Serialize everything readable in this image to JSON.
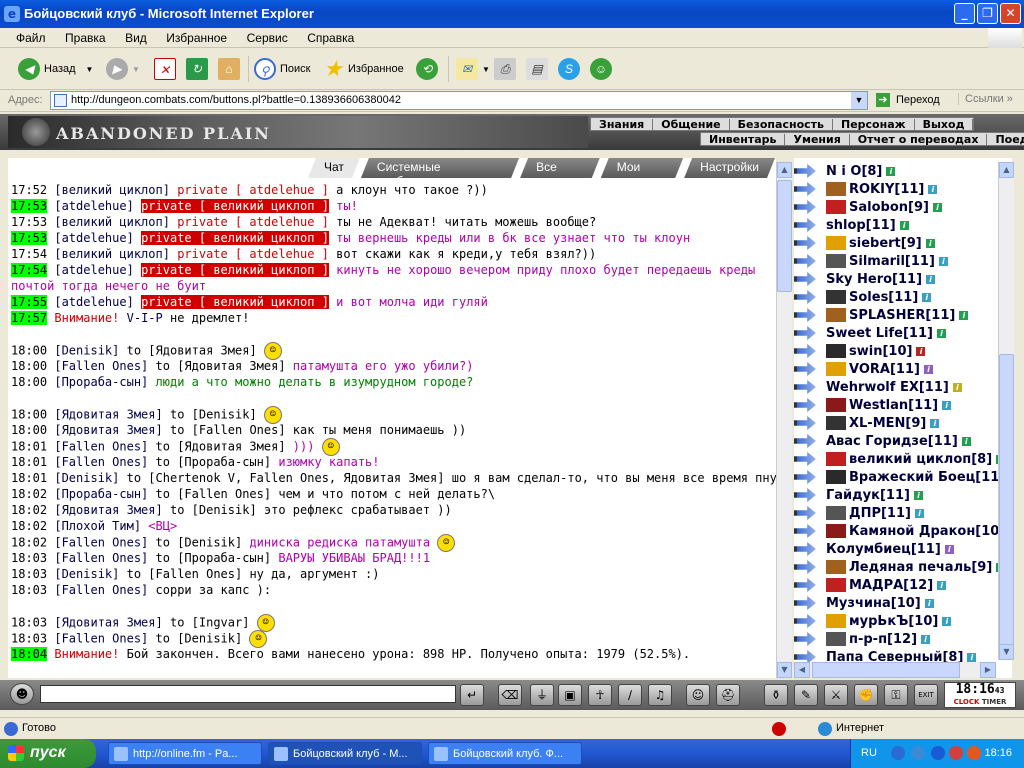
{
  "window": {
    "title": "Бойцовский клуб - Microsoft Internet Explorer",
    "icon": "ie-icon"
  },
  "menu": [
    "Файл",
    "Правка",
    "Вид",
    "Избранное",
    "Сервис",
    "Справка"
  ],
  "toolbar": {
    "back": "Назад",
    "search": "Поиск",
    "favorites": "Избранное"
  },
  "address": {
    "label": "Адрес:",
    "url": "http://dungeon.combats.com/buttons.pl?battle=0.138936606380042",
    "go": "Переход",
    "links": "Ссылки"
  },
  "game": {
    "location": "ABANDONED PLAIN",
    "nav_top": [
      "Знания",
      "Общение",
      "Безопасность",
      "Персонаж",
      "Выход"
    ],
    "nav_bottom": [
      "Инвентарь",
      "Умения",
      "Отчет о переводах",
      "Поединки",
      "А"
    ]
  },
  "tabs": [
    "Чат",
    "Системные сообщения",
    "Все логи",
    "Мои логи",
    "Настройки"
  ],
  "chat": [
    {
      "time": "17:52",
      "hl": false,
      "name": "[великий циклоп]",
      "private": "private [ atdelehue ]",
      "text": "а клоун что такое ?))"
    },
    {
      "time": "17:53",
      "hl": true,
      "name": "[atdelehue]",
      "private": "private [ великий циклоп ]",
      "text": "ты!"
    },
    {
      "time": "17:53",
      "hl": false,
      "name": "[великий циклоп]",
      "private": "private [ atdelehue ]",
      "text": "ты не Адекват! читать можешь вообще?"
    },
    {
      "time": "17:53",
      "hl": true,
      "name": "[atdelehue]",
      "private": "private [ великий циклоп ]",
      "text": "ты вернешь креды или в бк все узнает что ты клоун"
    },
    {
      "time": "17:54",
      "hl": false,
      "name": "[великий циклоп]",
      "private": "private [ atdelehue ]",
      "text": "вот скажи как я креди,у тебя взял?))"
    },
    {
      "time": "17:54",
      "hl": true,
      "name": "[atdelehue]",
      "private": "private [ великий циклоп ]",
      "text": "кинуть не хорошо вечером приду плохо будет передаешь креды почтой тогда нечего не буит"
    },
    {
      "time": "17:55",
      "hl": true,
      "name": "[atdelehue]",
      "private": "private [ великий циклоп ]",
      "text": "и вот молча иди гуляй"
    },
    {
      "time": "17:57",
      "hl": true,
      "warn": "Внимание!",
      "name": "V-I-P",
      "text": "не дремлет!"
    },
    {
      "time": "18:00",
      "name": "[Denisik]",
      "to": "to [Ядовитая Змея]",
      "text": "",
      "smiley": "smiley-icon"
    },
    {
      "time": "18:00",
      "name": "[Fallen Ones]",
      "to": "to [Ядовитая Змея]",
      "text": "патамушта его ужо убили?)"
    },
    {
      "time": "18:00",
      "name": "[Прораба-сын]",
      "to": "",
      "text": "люди а что можно делать в изумрудном городе?"
    },
    {
      "time": "18:00",
      "name": "[Ядовитая Змея]",
      "to": "to [Denisik]",
      "text": "",
      "smiley": "viking-smiley-icon"
    },
    {
      "time": "18:00",
      "name": "[Ядовитая Змея]",
      "to": "to [Fallen Ones]",
      "text": "как ты меня понимаешь ))"
    },
    {
      "time": "18:01",
      "name": "[Fallen Ones]",
      "to": "to [Ядовитая Змея]",
      "text": ")))",
      "smiley": "ninja-smiley-icon"
    },
    {
      "time": "18:01",
      "name": "[Fallen Ones]",
      "to": "to [Прораба-сын]",
      "text": "изюмку капать!"
    },
    {
      "time": "18:01",
      "name": "[Denisik]",
      "to": "to [Chertenok V, Fallen Ones, Ядовитая Змея]",
      "text": "шо я вам сделал-то, что вы меня все время пнуть хотите? :)"
    },
    {
      "time": "18:02",
      "name": "[Прораба-сын]",
      "to": "to [Fallen Ones]",
      "text": "чем и что потом с ней делать?\\"
    },
    {
      "time": "18:02",
      "name": "[Ядовитая Змея]",
      "to": "to [Denisik]",
      "text": "это рефлекс срабатывает ))"
    },
    {
      "time": "18:02",
      "name": "[Плохой Тим]",
      "to": "",
      "text": "<ВЦ>"
    },
    {
      "time": "18:02",
      "name": "[Fallen Ones]",
      "to": "to [Denisik]",
      "text": "диниска редиска патамушта",
      "smiley": "angry-smiley-icon"
    },
    {
      "time": "18:03",
      "name": "[Fallen Ones]",
      "to": "to [Прораба-сын]",
      "text": "ВАРУЫ УБИВАЫ БРАД!!!1"
    },
    {
      "time": "18:03",
      "name": "[Denisik]",
      "to": "to [Fallen Ones]",
      "text": "ну да, аргумент :)"
    },
    {
      "time": "18:03",
      "name": "[Fallen Ones]",
      "to": "",
      "text": "сорри за капс ):"
    },
    {
      "time": "18:03",
      "name": "[Ядовитая Змея]",
      "to": "to [Ingvar]",
      "text": "",
      "smiley": "cheer-smiley-icon"
    },
    {
      "time": "18:03",
      "name": "[Fallen Ones]",
      "to": "to [Denisik]",
      "text": "",
      "smiley": "angry-smiley-icon"
    },
    {
      "time": "18:04",
      "hl": true,
      "warn": "Внимание!",
      "name": "",
      "text": "Бой закончен. Всего вами нанесено урона: 898 HP. Получено опыта: 1979 (52.5%)."
    }
  ],
  "users": [
    {
      "name": "N i O",
      "lvl": "[8]",
      "info": "green"
    },
    {
      "name": "ROKIY",
      "lvl": "[11]",
      "info": "blue"
    },
    {
      "name": "Salobon",
      "lvl": "[9]",
      "info": "green"
    },
    {
      "name": "shlop",
      "lvl": "[11]",
      "info": "green"
    },
    {
      "name": "siebert",
      "lvl": "[9]",
      "info": "green"
    },
    {
      "name": "Silmaril",
      "lvl": "[11]",
      "info": "blue"
    },
    {
      "name": "Sky Hero",
      "lvl": "[11]",
      "info": "blue"
    },
    {
      "name": "Soles",
      "lvl": "[11]",
      "info": "blue"
    },
    {
      "name": "SPLASHER",
      "lvl": "[11]",
      "info": "green"
    },
    {
      "name": "Sweet Life",
      "lvl": "[11]",
      "info": "green"
    },
    {
      "name": "swin",
      "lvl": "[10]",
      "info": "red"
    },
    {
      "name": "VORA",
      "lvl": "[11]",
      "info": "pur"
    },
    {
      "name": "Wehrwolf EX",
      "lvl": "[11]",
      "info": "yel"
    },
    {
      "name": "Westlan",
      "lvl": "[11]",
      "info": "blue"
    },
    {
      "name": "XL-MEN",
      "lvl": "[9]",
      "info": "blue"
    },
    {
      "name": "Авас Горидзе",
      "lvl": "[11]",
      "info": "green"
    },
    {
      "name": "великий циклоп",
      "lvl": "[8]",
      "info": "green"
    },
    {
      "name": "Вражеский Боец",
      "lvl": "[11]",
      "info": "green"
    },
    {
      "name": "Гайдук",
      "lvl": "[11]",
      "info": "green"
    },
    {
      "name": "ДПР",
      "lvl": "[11]",
      "info": "blue"
    },
    {
      "name": "Камяной Дракон",
      "lvl": "[10]",
      "info": "yel"
    },
    {
      "name": "Колумбиец",
      "lvl": "[11]",
      "info": "pur"
    },
    {
      "name": "Ледяная печаль",
      "lvl": "[9]",
      "info": "green"
    },
    {
      "name": "МАДРА",
      "lvl": "[12]",
      "info": "blue"
    },
    {
      "name": "Музчина",
      "lvl": "[10]",
      "info": "blue"
    },
    {
      "name": "мурЬкЪ",
      "lvl": "[10]",
      "info": "blue"
    },
    {
      "name": "п-р-п",
      "lvl": "[12]",
      "info": "blue"
    },
    {
      "name": "Папа Северный",
      "lvl": "[8]",
      "info": "blue"
    }
  ],
  "clock": {
    "time": "18:16",
    "secs": "43",
    "label1": "CLOCK",
    "label2": "TIMER"
  },
  "status": {
    "text": "Готово",
    "zone": "Интернет"
  },
  "taskbar": {
    "start": "пуск",
    "tasks": [
      "http://online.fm - Pa...",
      "Бойцовский клуб - M...",
      "Бойцовский клуб. Ф..."
    ],
    "lang": "RU",
    "time": "18:16"
  }
}
